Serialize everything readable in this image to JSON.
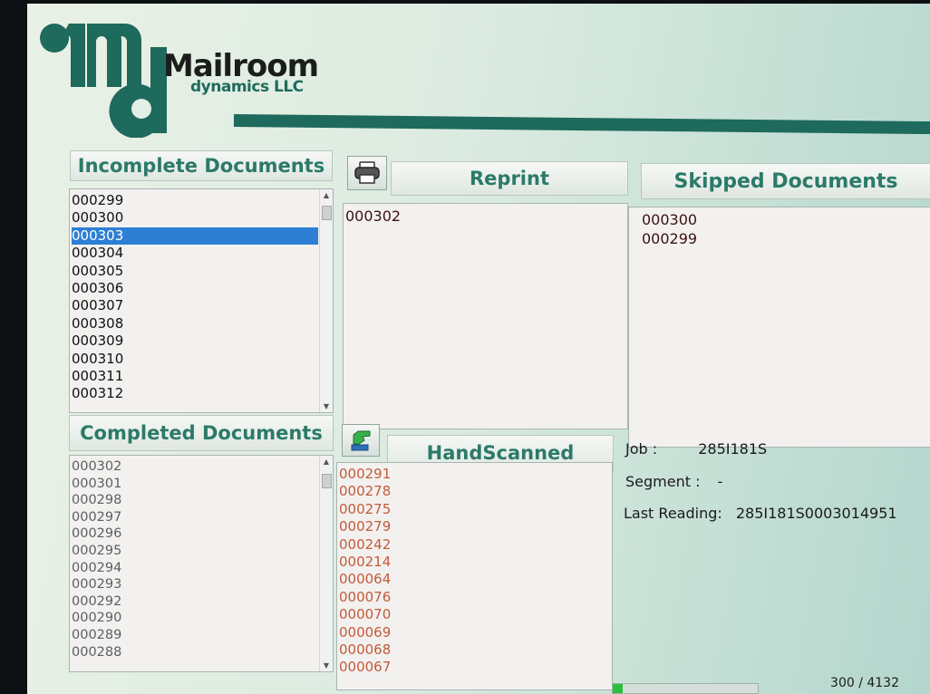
{
  "brand": {
    "name": "Mailroom",
    "tagline": "dynamics LLC",
    "monogram": "md"
  },
  "incomplete": {
    "title": "Incomplete Documents",
    "items": [
      "000299",
      "000300",
      "000303",
      "000304",
      "000305",
      "000306",
      "000307",
      "000308",
      "000309",
      "000310",
      "000311",
      "000312"
    ],
    "selected": "000303"
  },
  "reprint": {
    "title": "Reprint",
    "icon": "printer-icon",
    "items": [
      "000302"
    ]
  },
  "skipped": {
    "title": "Skipped Documents",
    "items": [
      "000300",
      "000299"
    ]
  },
  "completed": {
    "title": "Completed Documents",
    "items": [
      "000302",
      "000301",
      "000298",
      "000297",
      "000296",
      "000295",
      "000294",
      "000293",
      "000292",
      "000290",
      "000289",
      "000288"
    ]
  },
  "handscanned": {
    "title": "HandScanned",
    "icon": "hand-scan-icon",
    "items": [
      "000291",
      "000278",
      "000275",
      "000279",
      "000242",
      "000214",
      "000064",
      "000076",
      "000070",
      "000069",
      "000068",
      "000067"
    ]
  },
  "info": {
    "job_label": "Job :",
    "job_value": "285I181S",
    "segment_label": "Segment :",
    "segment_value": "-",
    "last_label": "Last Reading:",
    "last_value": "285I181S0003014951"
  },
  "status": {
    "counter": "300 / 4132",
    "progress": 0.07
  },
  "colors": {
    "accent": "#2c7a68",
    "brand_dark": "#1e6a5c",
    "selection": "#2d7fd4",
    "handscanned_text": "#c35a3a"
  }
}
